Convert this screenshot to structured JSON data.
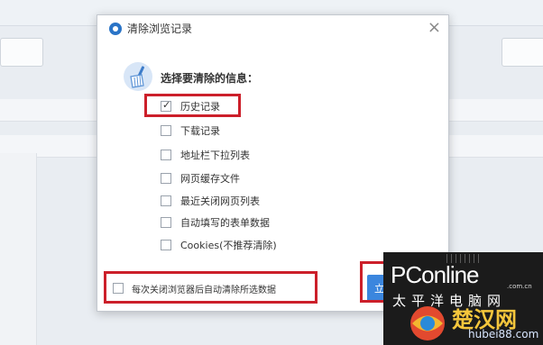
{
  "dialog": {
    "title": "清除浏览记录",
    "close_glyph": "×",
    "heading": "选择要清除的信息：",
    "options": [
      {
        "label": "历史记录",
        "checked": true,
        "highlighted": true
      },
      {
        "label": "下载记录",
        "checked": false
      },
      {
        "label": "地址栏下拉列表",
        "checked": false
      },
      {
        "label": "网页缓存文件",
        "checked": false
      },
      {
        "label": "最近关闭网页列表",
        "checked": false
      },
      {
        "label": "自动填写的表单数据",
        "checked": false
      },
      {
        "label": "Cookies(不推荐清除)",
        "checked": false
      }
    ],
    "auto_clear_label": "每次关闭浏览器后自动清除所选数据",
    "auto_clear_checked": false,
    "clear_button_label": "立"
  },
  "watermark": {
    "brand": "PConline",
    "dotcom": ".com.cn",
    "brand_cn": "太平洋电脑网",
    "big_text": "楚汉网",
    "url": "hubei88.com"
  },
  "colors": {
    "highlight_border": "#cc1f2a",
    "button_blue": "#3b86de",
    "title_icon_blue": "#2a74c7"
  },
  "icons": {
    "title": "browser-logo-icon",
    "broom": "broom-icon",
    "close": "close-icon"
  }
}
